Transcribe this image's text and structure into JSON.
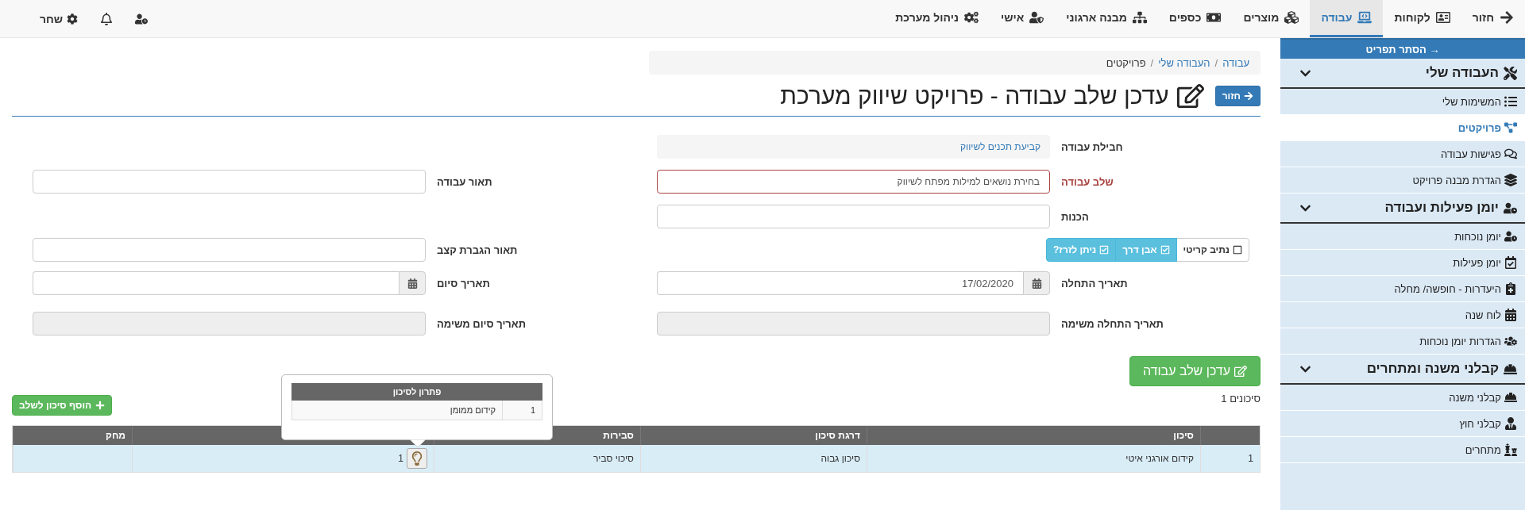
{
  "topnav": {
    "items": [
      {
        "label": "חזור",
        "selected": false
      },
      {
        "label": "לקוחות",
        "selected": false
      },
      {
        "label": "עבודה",
        "selected": true
      },
      {
        "label": "מוצרים",
        "selected": false
      },
      {
        "label": "כספים",
        "selected": false
      },
      {
        "label": "מבנה ארגוני",
        "selected": false
      },
      {
        "label": "אישי",
        "selected": false
      },
      {
        "label": "ניהול מערכת",
        "selected": false
      }
    ],
    "user": {
      "name": "שחר"
    }
  },
  "sidebar": {
    "hide_label": "→ הסתר תפריט",
    "groups": [
      {
        "title": "העבודה שלי",
        "expanded": true,
        "items": [
          {
            "label": "המשימות שלי",
            "selected": false
          },
          {
            "label": "פרויקטים",
            "selected": true
          },
          {
            "label": "פגישות עבודה",
            "selected": false
          },
          {
            "label": "הגדרת מבנה פרויקט",
            "selected": false
          }
        ]
      },
      {
        "title": "יומן פעילות ועבודה",
        "expanded": true,
        "items": [
          {
            "label": "יומן נוכחות",
            "selected": false
          },
          {
            "label": "יומן פעילות",
            "selected": false
          },
          {
            "label": "היעדרות - חופשה/ מחלה",
            "selected": false
          },
          {
            "label": "לוח שנה",
            "selected": false
          },
          {
            "label": "הגדרות יומן נוכחות",
            "selected": false
          }
        ]
      },
      {
        "title": "קבלני משנה ומתחרים",
        "expanded": true,
        "items": [
          {
            "label": "קבלני משנה",
            "selected": false
          },
          {
            "label": "קבלני חוץ",
            "selected": false
          },
          {
            "label": "מתחרים",
            "selected": false
          }
        ]
      }
    ]
  },
  "breadcrumb": {
    "separator": "/",
    "items": [
      {
        "label": "עבודה",
        "selected": false
      },
      {
        "label": "העבודה שלי",
        "selected": false
      },
      {
        "label": "פרויקטים",
        "selected": true
      }
    ]
  },
  "back_button": "חזור",
  "title": "עדכן שלב עבודה - פרויקט שיווק מערכת",
  "form_rows": [
    {
      "right": {
        "kind": "static",
        "label": "חבילת עבודה",
        "value": "קביעת תכנים לשיווק"
      }
    },
    {
      "right": {
        "kind": "text",
        "label": "שלב עבודה",
        "value": "בחירת נושאים למילות מפתח לשיווק",
        "invalid": true
      },
      "left": {
        "kind": "text",
        "label": "תאור עבודה",
        "invalid": false
      }
    },
    {
      "right": {
        "kind": "text",
        "label": "הכנות",
        "invalid": false
      }
    },
    {
      "right": {
        "kind": "toggles",
        "options": [
          {
            "label": "נתיב קריטי",
            "checked": false
          },
          {
            "label": "אבן דרך",
            "checked": true
          },
          {
            "label": "ניתן לזרז?",
            "checked": true
          }
        ]
      },
      "left": {
        "kind": "text",
        "label": "תאור הגברת קצב",
        "invalid": false
      }
    },
    {
      "right": {
        "kind": "date",
        "label": "תאריך התחלה",
        "value": "17/02/2020"
      },
      "left": {
        "kind": "date",
        "label": "תאריך סיום"
      }
    },
    {
      "right": {
        "kind": "disabled",
        "label": "תאריך התחלה משימה"
      },
      "left": {
        "kind": "disabled",
        "label": "תאריך סיום משימה"
      }
    }
  ],
  "update_button": "עדכן שלב עבודה",
  "risk_count": "סיכונים 1",
  "add_risk_button": "הוסף סיכון לשלב",
  "risks_table": {
    "columns": [
      {
        "kind": "blank"
      },
      {
        "kind": "text",
        "label": "סיכון"
      },
      {
        "kind": "text",
        "label": "דרגת סיכון"
      },
      {
        "kind": "text",
        "label": "סבירות"
      },
      {
        "kind": "blank"
      },
      {
        "kind": "text",
        "label": "מחק"
      }
    ],
    "rows": [
      {
        "index": "1",
        "risk": "קידום אורגני איטי",
        "level": "סיכון גבוה",
        "likelihood": "סיכוי סביר",
        "solutions_count": "1"
      }
    ]
  },
  "solutions_popover": {
    "heading": "פתרון לסיכון",
    "rows": [
      {
        "index": "1",
        "text": "קידום ממומן"
      }
    ]
  }
}
